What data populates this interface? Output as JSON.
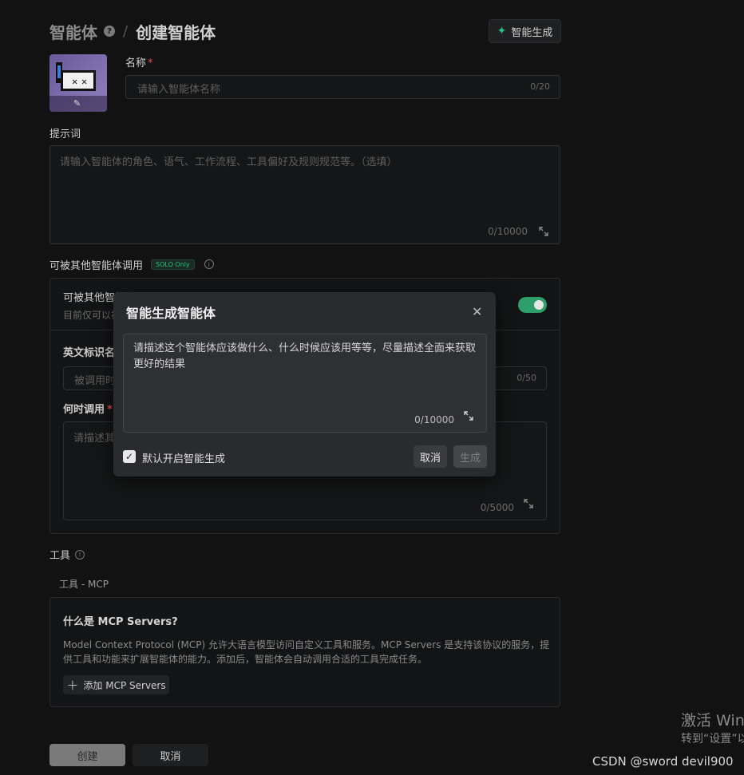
{
  "header": {
    "breadcrumb_root": "智能体",
    "breadcrumb_sep": "/",
    "page_title": "创建智能体",
    "ai_generate_label": "智能生成"
  },
  "name_field": {
    "label": "名称",
    "required": "*",
    "placeholder": "请输入智能体名称",
    "counter": "0/20"
  },
  "prompt_field": {
    "label": "提示词",
    "placeholder": "请输入智能体的角色、语气、工作流程、工具偏好及规则规范等。（选填）",
    "counter": "0/10000"
  },
  "callable_section": {
    "label": "可被其他智能体调用",
    "badge": "SOLO Only",
    "row_title": "可被其他智能体调用",
    "row_desc": "目前仅可以被",
    "toggle_on": true,
    "english_id_label": "英文标识名",
    "english_id_placeholder": "被调用时",
    "english_id_counter": "0/50",
    "when_label": "何时调用",
    "when_required": "*",
    "when_placeholder": "请描述其",
    "when_counter": "0/5000"
  },
  "tools": {
    "label": "工具",
    "mcp_label": "工具 - MCP",
    "mcp_title": "什么是 MCP Servers?",
    "mcp_desc": "Model Context Protocol (MCP) 允许大语言模型访问自定义工具和服务。MCP Servers 是支持该协议的服务，提供工具和功能来扩展智能体的能力。添加后，智能体会自动调用合适的工具完成任务。",
    "add_mcp_label": "添加 MCP Servers"
  },
  "footer": {
    "create_label": "创建",
    "cancel_label": "取消"
  },
  "modal": {
    "title": "智能生成智能体",
    "placeholder": "请描述这个智能体应该做什么、什么时候应该用等等，尽量描述全面来获取更好的结果",
    "counter": "0/10000",
    "checkbox_label": "默认开启智能生成",
    "checkbox_checked": true,
    "cancel_label": "取消",
    "generate_label": "生成"
  },
  "watermark": {
    "activate_line1": "激活 Win",
    "activate_line2": "转到“设置”以",
    "csdn": "CSDN @sword devil900"
  },
  "colors": {
    "accent_green": "#22c38a",
    "toggle_green": "#2e9e6b",
    "required_red": "#e5484d"
  }
}
